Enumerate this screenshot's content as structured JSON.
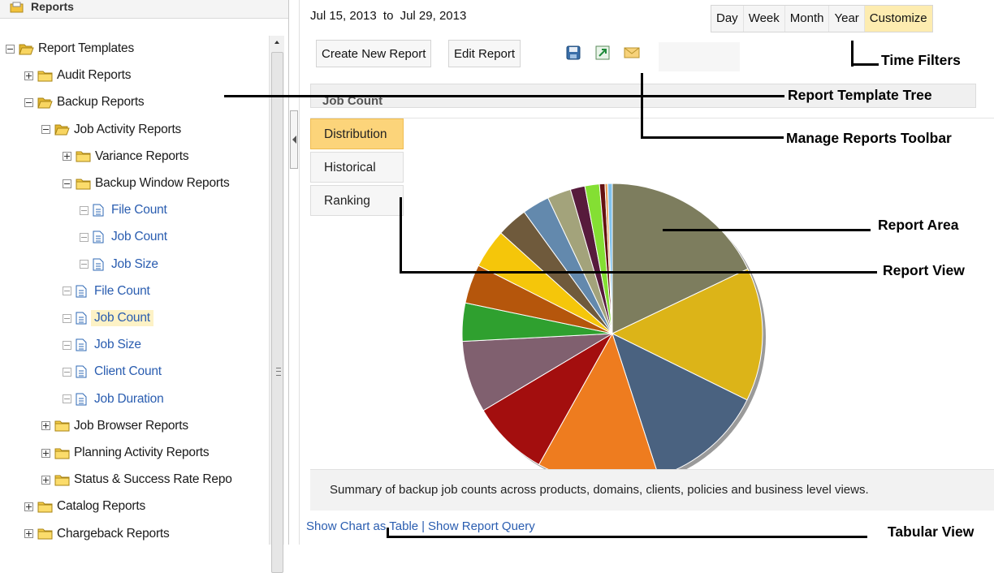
{
  "left_panel": {
    "header_label": "Reports",
    "tree": [
      {
        "label": "Report Templates",
        "level": 0,
        "expander": "minus",
        "icon": "folder-open-icon",
        "style": "plain"
      },
      {
        "label": "Audit Reports",
        "level": 1,
        "expander": "plus",
        "icon": "folder-icon",
        "style": "plain"
      },
      {
        "label": "Backup Reports",
        "level": 1,
        "expander": "minus",
        "icon": "folder-open-icon",
        "style": "plain"
      },
      {
        "label": "Job Activity Reports",
        "level": 2,
        "expander": "minus",
        "icon": "folder-open-icon",
        "style": "plain"
      },
      {
        "label": "Variance Reports",
        "level": 3,
        "expander": "plus",
        "icon": "folder-icon",
        "style": "plain"
      },
      {
        "label": "Backup Window Reports",
        "level": 3,
        "expander": "minus",
        "icon": "folder-icon",
        "style": "plain"
      },
      {
        "label": "File Count",
        "level": 4,
        "expander": "leaf",
        "icon": "document-icon",
        "style": "link"
      },
      {
        "label": "Job Count",
        "level": 4,
        "expander": "leaf",
        "icon": "document-icon",
        "style": "link"
      },
      {
        "label": "Job Size",
        "level": 4,
        "expander": "leaf",
        "icon": "document-icon",
        "style": "link"
      },
      {
        "label": "File Count",
        "level": 3,
        "expander": "leaf",
        "icon": "document-icon",
        "style": "link"
      },
      {
        "label": "Job Count",
        "level": 3,
        "expander": "leaf",
        "icon": "document-icon",
        "style": "selected"
      },
      {
        "label": "Job Size",
        "level": 3,
        "expander": "leaf",
        "icon": "document-icon",
        "style": "link"
      },
      {
        "label": "Client Count",
        "level": 3,
        "expander": "leaf",
        "icon": "document-icon",
        "style": "link"
      },
      {
        "label": "Job Duration",
        "level": 3,
        "expander": "leaf",
        "icon": "document-icon",
        "style": "link"
      },
      {
        "label": "Job Browser Reports",
        "level": 2,
        "expander": "plus",
        "icon": "folder-icon",
        "style": "plain"
      },
      {
        "label": "Planning Activity Reports",
        "level": 2,
        "expander": "plus",
        "icon": "folder-icon",
        "style": "plain"
      },
      {
        "label": "Status & Success Rate Repo",
        "level": 2,
        "expander": "plus",
        "icon": "folder-icon",
        "style": "plain"
      },
      {
        "label": "Catalog Reports",
        "level": 1,
        "expander": "plus",
        "icon": "folder-icon",
        "style": "plain"
      },
      {
        "label": "Chargeback Reports",
        "level": 1,
        "expander": "plus",
        "icon": "folder-icon",
        "style": "plain"
      }
    ]
  },
  "date_range": {
    "from": "Jul 15, 2013",
    "separator": "to",
    "to": "Jul 29, 2013"
  },
  "time_filters": {
    "options": [
      "Day",
      "Week",
      "Month",
      "Year",
      "Customize"
    ],
    "active": "Customize"
  },
  "toolbar": {
    "create_label": "Create New Report",
    "edit_label": "Edit Report",
    "icons": [
      "export-disk-icon",
      "open-external-icon",
      "email-icon"
    ]
  },
  "report": {
    "title": "Job Count",
    "views": [
      "Distribution",
      "Historical",
      "Ranking"
    ],
    "active_view": "Distribution",
    "summary": "Summary of backup job counts across products, domains, clients, policies and business level views."
  },
  "bottom_links": {
    "show_table": "Show Chart as Table",
    "show_query": "Show Report Query"
  },
  "chart_data": {
    "type": "pie",
    "slices": [
      {
        "value": 18.3,
        "color": "#7d7d5e"
      },
      {
        "value": 14.7,
        "color": "#dcb418"
      },
      {
        "value": 13.0,
        "color": "#4a6280"
      },
      {
        "value": 13.4,
        "color": "#ee7c1f"
      },
      {
        "value": 8.5,
        "color": "#a30e0e"
      },
      {
        "value": 7.9,
        "color": "#80606f"
      },
      {
        "value": 4.2,
        "color": "#2fa02f"
      },
      {
        "value": 4.3,
        "color": "#b5560c"
      },
      {
        "value": 4.3,
        "color": "#f5c60a"
      },
      {
        "value": 3.4,
        "color": "#6f5a3c"
      },
      {
        "value": 3.0,
        "color": "#6389ad"
      },
      {
        "value": 2.6,
        "color": "#a3a37b"
      },
      {
        "value": 1.6,
        "color": "#571b3c"
      },
      {
        "value": 1.6,
        "color": "#84df33"
      },
      {
        "value": 0.6,
        "color": "#641111"
      },
      {
        "value": 0.3,
        "color": "#e8a05a"
      },
      {
        "value": 0.5,
        "color": "#7fc2ee"
      }
    ]
  },
  "callouts": {
    "time_filters": "Time Filters",
    "template_tree": "Report Template Tree",
    "toolbar": "Manage Reports Toolbar",
    "report_area": "Report Area",
    "report_view": "Report View",
    "tabular_view": "Tabular View"
  },
  "colors": {
    "link": "#2a5db0",
    "active_tab": "#fcd47a",
    "active_filter": "#fdecb0",
    "selected_node": "#fdf2c6"
  }
}
